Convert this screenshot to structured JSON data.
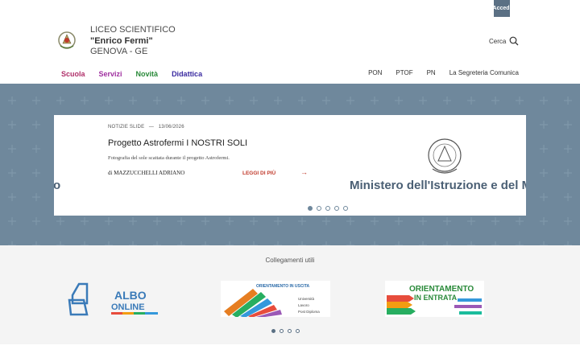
{
  "topbar": {
    "login_label": "Accedi"
  },
  "header": {
    "line1": "LICEO SCIENTIFICO",
    "line2": "\"Enrico Fermi\"",
    "line3": "GENOVA - GE",
    "search_label": "Cerca"
  },
  "main_nav": [
    {
      "label": "Scuola",
      "color": "#b0306a"
    },
    {
      "label": "Servizi",
      "color": "#a030a0"
    },
    {
      "label": "Novità",
      "color": "#2a8a3a"
    },
    {
      "label": "Didattica",
      "color": "#3a2aa0"
    }
  ],
  "secondary_nav": [
    "PON",
    "PTOF",
    "PN",
    "La Segreteria Comunica"
  ],
  "hero": {
    "meta_category": "NOTIZIE SLIDE",
    "meta_sep": "—",
    "meta_date": "13/06/2026",
    "title": "Progetto Astrofermi I NOSTRI SOLI",
    "description": "Fotografia del sole scattata durante il progetto Astrofermi.",
    "author": "di MAZZUCCHELLI ADRIANO",
    "read_more": "LEGGI DI PIÙ",
    "left_text": "rito",
    "right_text": "Ministero dell'Istruzione e del M",
    "slides_count": 5,
    "active_slide": 1
  },
  "links": {
    "title": "Collegamenti utili",
    "albo": {
      "line1": "ALBO",
      "line2": "ONLINE"
    },
    "orient_out": {
      "title": "ORIENTAMENTO IN USCITA",
      "items": [
        "Università",
        "Lavoro",
        "Post Diploma"
      ]
    },
    "orient_in": {
      "title": "ORIENTAMENTO",
      "title2": "IN ENTRATA"
    },
    "pages_count": 4,
    "active_page": 1
  },
  "colors": {
    "hero_bg": "#6f889c",
    "accent": "#5b7084",
    "read_more": "#c0392b"
  }
}
